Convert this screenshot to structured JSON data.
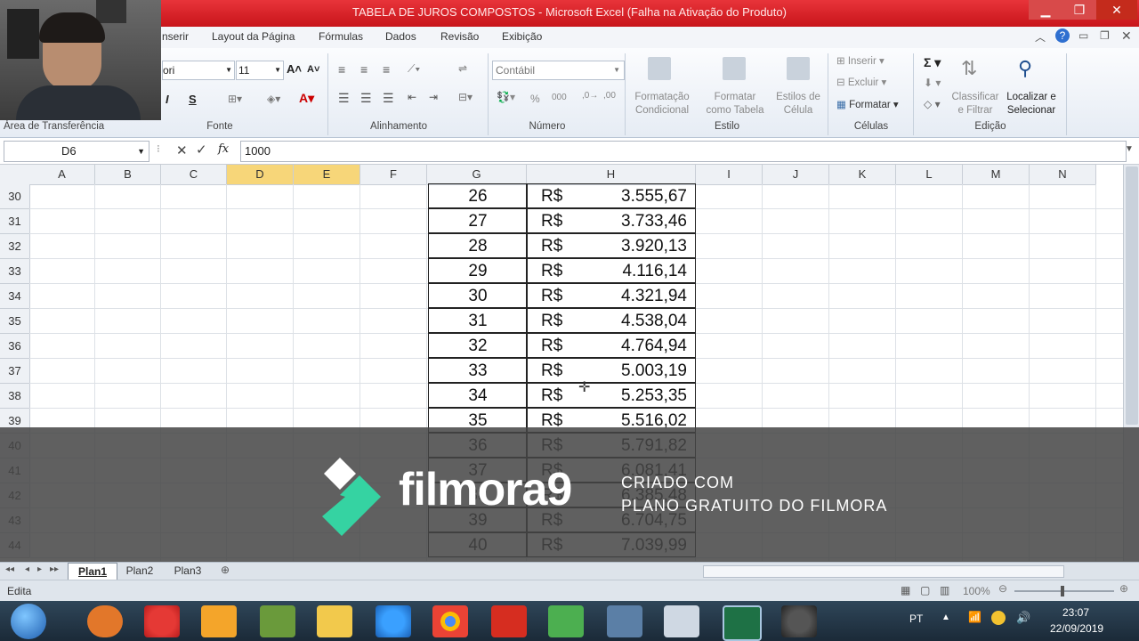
{
  "window": {
    "title": "TABELA DE JUROS COMPOSTOS - Microsoft Excel (Falha na Ativação do Produto)",
    "controls": {
      "minimize": "▁",
      "restore": "❐",
      "close": "✕"
    }
  },
  "ribbon_tabs": [
    "nserir",
    "Layout da Página",
    "Fórmulas",
    "Dados",
    "Revisão",
    "Exibição"
  ],
  "ribbon": {
    "clipboard_label": "Área de Transferência",
    "font_group_label": "Fonte",
    "font_name": "ori",
    "font_size": "11",
    "alignment_group_label": "Alinhamento",
    "number_group_label": "Número",
    "number_format": "Contábil",
    "style_group_label": "Estilo",
    "cond_format": [
      "Formatação",
      "Condicional"
    ],
    "format_table": [
      "Formatar",
      "como Tabela"
    ],
    "cell_styles": [
      "Estilos de",
      "Célula"
    ],
    "cells_group_label": "Células",
    "insert": "Inserir",
    "delete": "Excluir",
    "format": "Formatar",
    "editing_group_label": "Edição",
    "sort_filter": [
      "Classificar",
      "e Filtrar"
    ],
    "find_select": [
      "Localizar e",
      "Selecionar"
    ]
  },
  "formula_bar": {
    "name_box": "D6",
    "formula": "1000",
    "fx": "fx"
  },
  "columns": [
    "A",
    "B",
    "C",
    "D",
    "E",
    "F",
    "G",
    "H",
    "I",
    "J",
    "K",
    "L",
    "M",
    "N"
  ],
  "selected_columns": [
    "D",
    "E"
  ],
  "rows": [
    {
      "row": "30",
      "period": "26",
      "currency": "R$",
      "value": "3.555,67"
    },
    {
      "row": "31",
      "period": "27",
      "currency": "R$",
      "value": "3.733,46"
    },
    {
      "row": "32",
      "period": "28",
      "currency": "R$",
      "value": "3.920,13"
    },
    {
      "row": "33",
      "period": "29",
      "currency": "R$",
      "value": "4.116,14"
    },
    {
      "row": "34",
      "period": "30",
      "currency": "R$",
      "value": "4.321,94"
    },
    {
      "row": "35",
      "period": "31",
      "currency": "R$",
      "value": "4.538,04"
    },
    {
      "row": "36",
      "period": "32",
      "currency": "R$",
      "value": "4.764,94"
    },
    {
      "row": "37",
      "period": "33",
      "currency": "R$",
      "value": "5.003,19"
    },
    {
      "row": "38",
      "period": "34",
      "currency": "R$",
      "value": "5.253,35"
    },
    {
      "row": "39",
      "period": "35",
      "currency": "R$",
      "value": "5.516,02"
    },
    {
      "row": "40",
      "period": "36",
      "currency": "R$",
      "value": "5.791,82"
    },
    {
      "row": "41",
      "period": "37",
      "currency": "R$",
      "value": "6.081,41"
    },
    {
      "row": "42",
      "period": "38",
      "currency": "R$",
      "value": "6.385,48"
    },
    {
      "row": "43",
      "period": "39",
      "currency": "R$",
      "value": "6.704,75"
    },
    {
      "row": "44",
      "period": "40",
      "currency": "R$",
      "value": "7.039,99"
    }
  ],
  "sheets": [
    "Plan1",
    "Plan2",
    "Plan3"
  ],
  "active_sheet": "Plan1",
  "status": {
    "mode": "Edita",
    "zoom": "100%"
  },
  "watermark": {
    "brand": "filmora9",
    "line1": "CRIADO COM",
    "line2": "PLANO GRATUITO DO FILMORA"
  },
  "taskbar": {
    "lang": "PT",
    "time": "23:07",
    "date": "22/09/2019"
  },
  "colors": {
    "title_red": "#d8202a",
    "selected_col": "#f7d679",
    "excel_green": "#1e7145"
  }
}
